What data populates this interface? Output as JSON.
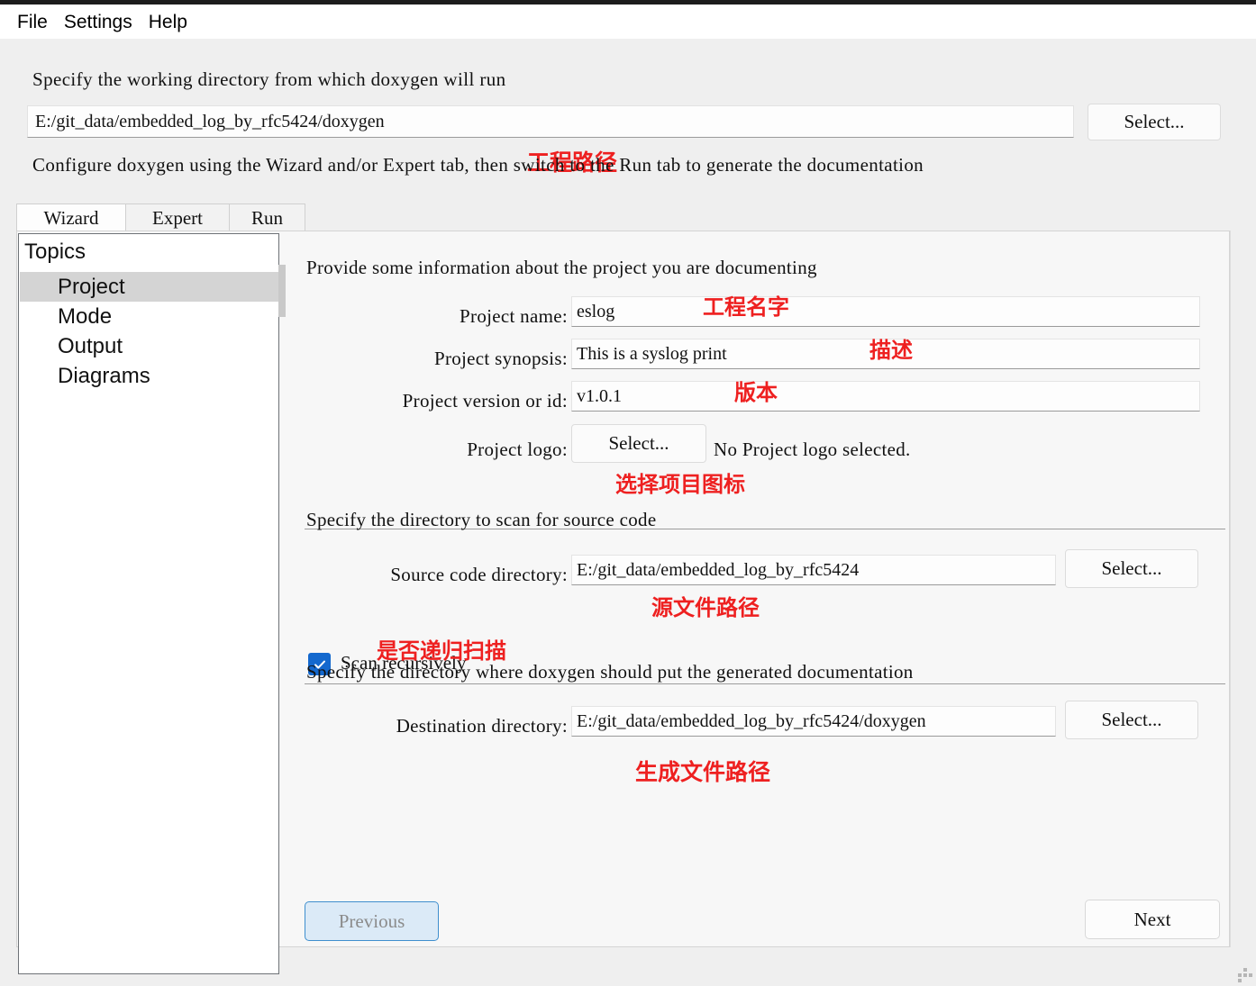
{
  "menubar": {
    "items": [
      {
        "label": "File"
      },
      {
        "label": "Settings"
      },
      {
        "label": "Help"
      }
    ]
  },
  "working_directory": {
    "description": "Specify the working directory from which doxygen will run",
    "value": "E:/git_data/embedded_log_by_rfc5424/doxygen",
    "select_button": "Select...",
    "annotation": "工程路径"
  },
  "configure_hint": "Configure doxygen using the Wizard and/or Expert tab, then switch to the Run tab to generate the documentation",
  "tabs": [
    {
      "label": "Wizard",
      "active": true
    },
    {
      "label": "Expert",
      "active": false
    },
    {
      "label": "Run",
      "active": false
    }
  ],
  "topics": {
    "title": "Topics",
    "items": [
      {
        "label": "Project",
        "selected": true
      },
      {
        "label": "Mode",
        "selected": false
      },
      {
        "label": "Output",
        "selected": false
      },
      {
        "label": "Diagrams",
        "selected": false
      }
    ]
  },
  "project_section": {
    "heading": "Provide some information about the project you are documenting",
    "project_name": {
      "label": "Project name:",
      "value": "eslog",
      "annotation": "工程名字"
    },
    "project_synopsis": {
      "label": "Project synopsis:",
      "value": "This is a syslog print",
      "annotation": "描述"
    },
    "project_version": {
      "label": "Project version or id:",
      "value": "v1.0.1",
      "annotation": "版本"
    },
    "project_logo": {
      "label": "Project logo:",
      "select_button": "Select...",
      "status": "No Project logo selected.",
      "annotation": "选择项目图标"
    }
  },
  "source_section": {
    "heading": "Specify the directory to scan for source code",
    "source_directory": {
      "label": "Source code directory:",
      "value": "E:/git_data/embedded_log_by_rfc5424",
      "select_button": "Select...",
      "annotation": "源文件路径"
    },
    "scan_recursively": {
      "label": "Scan recursively",
      "checked": true,
      "annotation": "是否递归扫描"
    }
  },
  "destination_section": {
    "heading": "Specify the directory where doxygen should put the generated documentation",
    "destination_directory": {
      "label": "Destination directory:",
      "value": "E:/git_data/embedded_log_by_rfc5424/doxygen",
      "select_button": "Select...",
      "annotation": "生成文件路径"
    }
  },
  "navigation": {
    "previous": "Previous",
    "next": "Next"
  },
  "colors": {
    "annotation_red": "#ee2020",
    "checkbox_blue": "#1368ce",
    "selection_gray": "#d4d4d4",
    "disabled_button_bg": "#dbeaf7"
  }
}
